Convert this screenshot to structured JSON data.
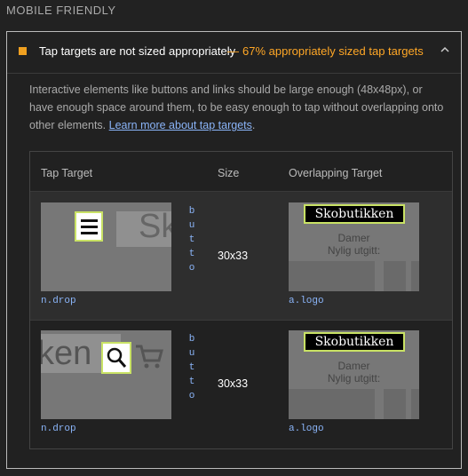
{
  "section": {
    "title": "MOBILE FRIENDLY"
  },
  "audit": {
    "title": "Tap targets are not sized appropriately",
    "separator": "—",
    "display_value": "67% appropriately sized tap targets",
    "status_color": "#f0a020",
    "description_text": "Interactive elements like buttons and links should be large enough (48x48px), or have enough space around them, to be easy enough to tap without overlapping onto other elements.",
    "learn_more_link": "Learn more about tap targets",
    "description_end": "."
  },
  "table": {
    "headers": [
      "Tap Target",
      "Size",
      "Overlapping Target"
    ],
    "rows": [
      {
        "tap_node": "n.drop",
        "tap_code": "butto",
        "size": "30x33",
        "overlap_node": "a.logo",
        "overlap_logo_text": "Skobutikken",
        "overlap_sub1": "Damer",
        "overlap_sub2": "Nylig utgitt:",
        "tap_bg_text": "Sk",
        "tap_icon": "hamburger-menu-icon"
      },
      {
        "tap_node": "n.drop",
        "tap_code": "butto",
        "size": "30x33",
        "overlap_node": "a.logo",
        "overlap_logo_text": "Skobutikken",
        "overlap_sub1": "Damer",
        "overlap_sub2": "Nylig utgitt:",
        "tap_bg_text": "ken",
        "tap_icon": "search-icon"
      }
    ]
  }
}
